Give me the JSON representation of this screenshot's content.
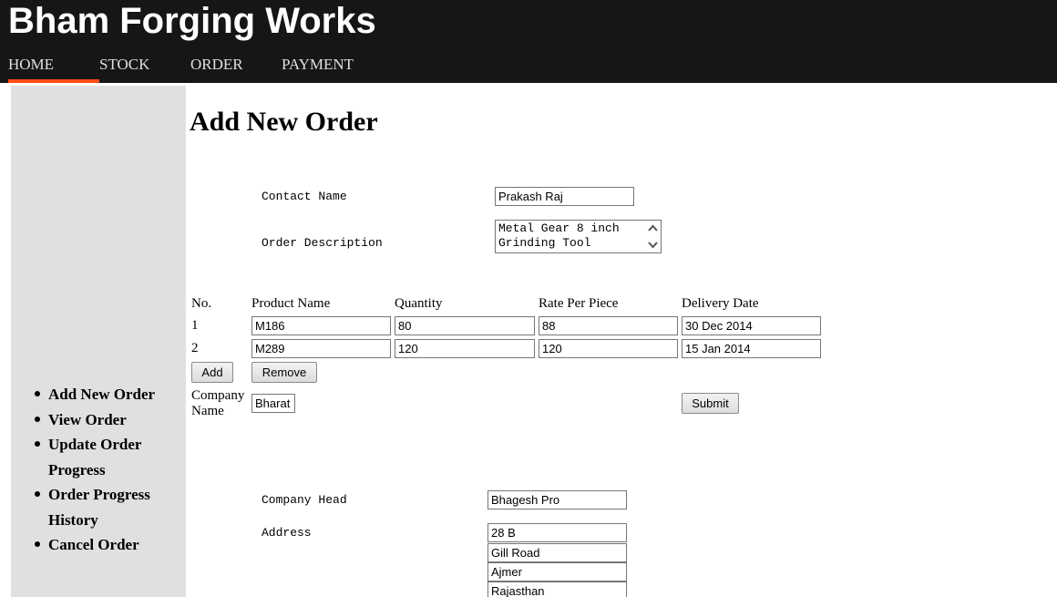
{
  "header": {
    "site_title": "Bham Forging Works",
    "accent_color": "#ff4b14",
    "background_color": "#161616"
  },
  "nav": {
    "items": [
      {
        "label": "HOME",
        "active": true
      },
      {
        "label": "STOCK",
        "active": false
      },
      {
        "label": "ORDER",
        "active": false
      },
      {
        "label": "PAYMENT",
        "active": false
      }
    ]
  },
  "sidebar": {
    "items": [
      {
        "label": "Add New Order"
      },
      {
        "label": "View Order"
      },
      {
        "label": "Update Order Progress"
      },
      {
        "label": "Order Progress History"
      },
      {
        "label": "Cancel Order"
      }
    ]
  },
  "main": {
    "page_title": "Add New Order",
    "contact": {
      "label": "Contact Name",
      "value": "Prakash Raj"
    },
    "description": {
      "label": "Order Description",
      "lines": [
        "Metal Gear 8 inch",
        "Grinding Tool"
      ]
    },
    "table": {
      "headers": [
        "No.",
        "Product Name",
        "Quantity",
        "Rate Per Piece",
        "Delivery Date"
      ],
      "rows": [
        {
          "no": "1",
          "product": "M186",
          "quantity": "80",
          "rate": "88",
          "date": "30 Dec 2014"
        },
        {
          "no": "2",
          "product": "M289",
          "quantity": "120",
          "rate": "120",
          "date": "15 Jan 2014"
        }
      ]
    },
    "buttons": {
      "add": "Add",
      "remove": "Remove",
      "submit": "Submit"
    },
    "company": {
      "label": "Company Name",
      "value": "Bharat"
    },
    "company_head": {
      "label": "Company Head",
      "value": "Bhagesh Pro"
    },
    "address": {
      "label": "Address",
      "lines": [
        "28 B",
        "Gill Road",
        "Ajmer",
        "Rajasthan"
      ]
    }
  }
}
